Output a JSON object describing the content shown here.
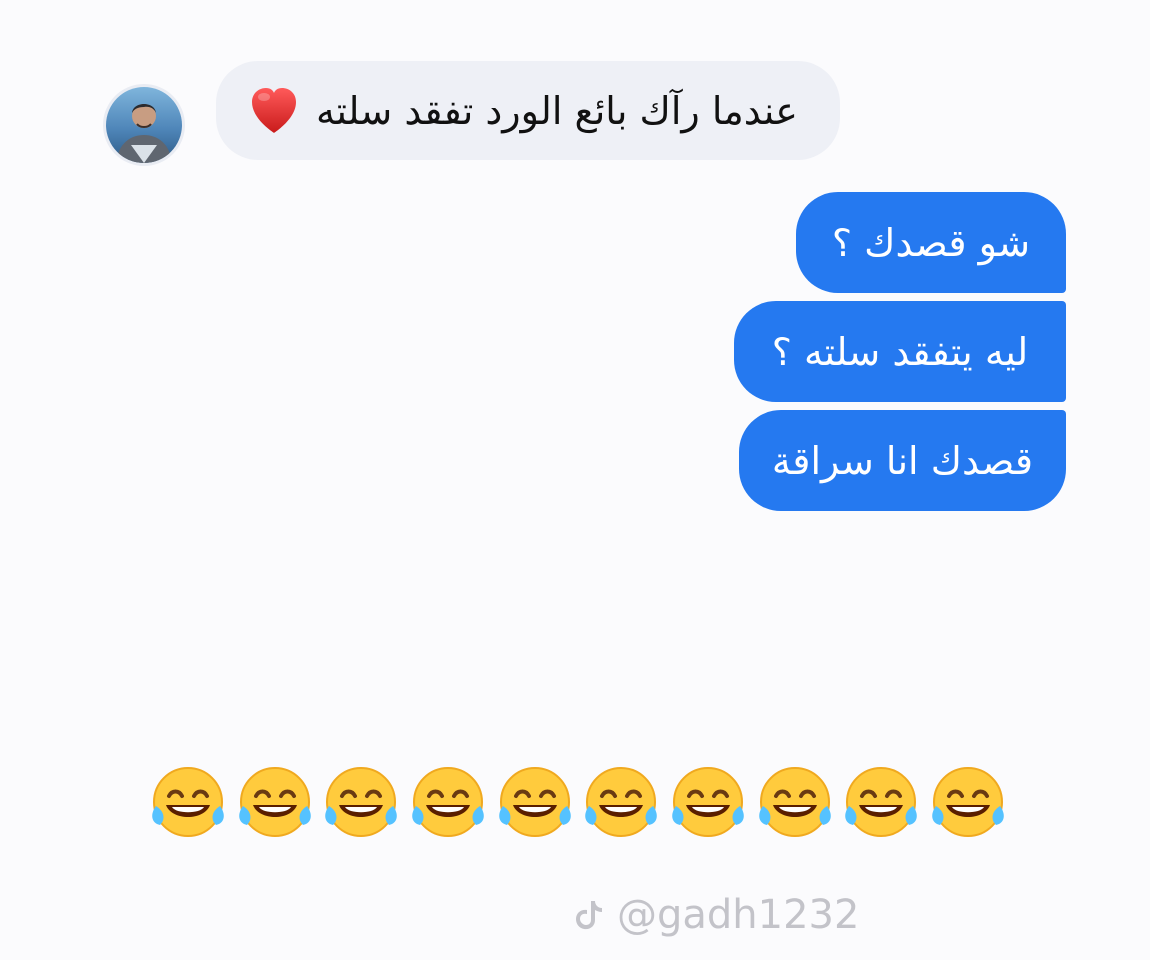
{
  "conversation": {
    "incoming": {
      "text": "عندما رآك بائع الورد تفقد سلته",
      "emoji": "heart-icon"
    },
    "outgoing": [
      {
        "text": "شو قصدك ؟"
      },
      {
        "text": "ليه يتفقد سلته ؟"
      },
      {
        "text": "قصدك انا سراقة"
      }
    ],
    "reactions": {
      "emoji": "face-with-tears-of-joy-icon",
      "count": 10
    }
  },
  "watermark": {
    "handle": "@gadh1232",
    "icon": "tiktok-icon"
  },
  "colors": {
    "background": "#fbfbfd",
    "incoming_bubble": "#eef0f6",
    "outgoing_bubble": "#2579f0",
    "outgoing_text": "#ffffff"
  }
}
